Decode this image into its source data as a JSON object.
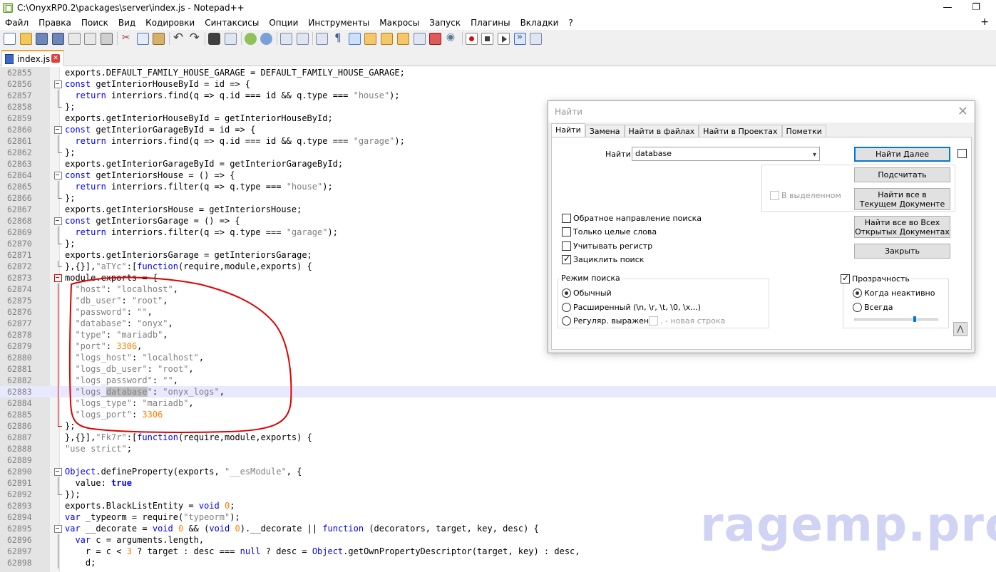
{
  "window": {
    "title": "C:\\OnyxRP0.2\\packages\\server\\index.js - Notepad++",
    "minimize_glyph": "—",
    "restore_glyph": "❐",
    "menu_close_glyph": "+"
  },
  "menu": [
    "Файл",
    "Правка",
    "Поиск",
    "Вид",
    "Кодировки",
    "Синтаксисы",
    "Опции",
    "Инструменты",
    "Макросы",
    "Запуск",
    "Плагины",
    "Вкладки",
    "?"
  ],
  "tab": {
    "label": "index.js",
    "close_glyph": "✕"
  },
  "code": [
    {
      "n": "62855",
      "fold": "",
      "h": "exports.DEFAULT_FAMILY_HOUSE_GARAGE = DEFAULT_FAMILY_HOUSE_GARAGE;"
    },
    {
      "n": "62856",
      "fold": "box",
      "h": "<span class=\"kw\">const</span> getInteriorHouseById = id =&gt; {"
    },
    {
      "n": "62857",
      "fold": "bar",
      "h": "  <span class=\"kw\">return</span> interriors.find(q =&gt; q.id === id &amp;&amp; q.type === <span class=\"str\">\"house\"</span>);"
    },
    {
      "n": "62858",
      "fold": "end",
      "h": "};"
    },
    {
      "n": "62859",
      "fold": "",
      "h": "exports.getInteriorHouseById = getInteriorHouseById;"
    },
    {
      "n": "62860",
      "fold": "box",
      "h": "<span class=\"kw\">const</span> getInteriorGarageById = id =&gt; {"
    },
    {
      "n": "62861",
      "fold": "bar",
      "h": "  <span class=\"kw\">return</span> interriors.find(q =&gt; q.id === id &amp;&amp; q.type === <span class=\"str\">\"garage\"</span>);"
    },
    {
      "n": "62862",
      "fold": "end",
      "h": "};"
    },
    {
      "n": "62863",
      "fold": "",
      "h": "exports.getInteriorGarageById = getInteriorGarageById;"
    },
    {
      "n": "62864",
      "fold": "box",
      "h": "<span class=\"kw\">const</span> getInteriorsHouse = () =&gt; {"
    },
    {
      "n": "62865",
      "fold": "bar",
      "h": "  <span class=\"kw\">return</span> interriors.filter(q =&gt; q.type === <span class=\"str\">\"house\"</span>);"
    },
    {
      "n": "62866",
      "fold": "end",
      "h": "};"
    },
    {
      "n": "62867",
      "fold": "",
      "h": "exports.getInteriorsHouse = getInteriorsHouse;"
    },
    {
      "n": "62868",
      "fold": "box",
      "h": "<span class=\"kw\">const</span> getInteriorsGarage = () =&gt; {"
    },
    {
      "n": "62869",
      "fold": "bar",
      "h": "  <span class=\"kw\">return</span> interriors.filter(q =&gt; q.type === <span class=\"str\">\"garage\"</span>);"
    },
    {
      "n": "62870",
      "fold": "end",
      "h": "};"
    },
    {
      "n": "62871",
      "fold": "",
      "h": "exports.getInteriorsGarage = getInteriorsGarage;"
    },
    {
      "n": "62872",
      "fold": "end",
      "h": "},{}],<span class=\"str\">\"aTYc\"</span>:[<span class=\"kw\">function</span>(require,module,exports) {"
    },
    {
      "n": "62873",
      "fold": "box red",
      "h": "module.exports = {"
    },
    {
      "n": "62874",
      "fold": "bar red",
      "h": "  <span class=\"str\">\"host\"</span>: <span class=\"str\">\"localhost\"</span>,"
    },
    {
      "n": "62875",
      "fold": "bar red",
      "h": "  <span class=\"str\">\"db_user\"</span>: <span class=\"str\">\"root\"</span>,"
    },
    {
      "n": "62876",
      "fold": "bar red",
      "h": "  <span class=\"str\">\"password\"</span>: <span class=\"str\">\"\"</span>,"
    },
    {
      "n": "62877",
      "fold": "bar red",
      "h": "  <span class=\"str\">\"database\"</span>: <span class=\"str\">\"onyx\"</span>,"
    },
    {
      "n": "62878",
      "fold": "bar red",
      "h": "  <span class=\"str\">\"type\"</span>: <span class=\"str\">\"mariadb\"</span>,"
    },
    {
      "n": "62879",
      "fold": "bar red",
      "h": "  <span class=\"str\">\"port\"</span>: <span class=\"num\">3306</span>,"
    },
    {
      "n": "62880",
      "fold": "bar red",
      "h": "  <span class=\"str\">\"logs_host\"</span>: <span class=\"str\">\"localhost\"</span>,"
    },
    {
      "n": "62881",
      "fold": "bar red",
      "h": "  <span class=\"str\">\"logs_db_user\"</span>: <span class=\"str\">\"root\"</span>,"
    },
    {
      "n": "62882",
      "fold": "bar red",
      "h": "  <span class=\"str\">\"logs_password\"</span>: <span class=\"str\">\"\"</span>,"
    },
    {
      "n": "62883",
      "fold": "bar red",
      "h": "  <span class=\"str\">\"logs_<span class=\"hl\">database</span>\"</span>: <span class=\"str\">\"onyx_logs\"</span>,",
      "current": true
    },
    {
      "n": "62884",
      "fold": "bar red",
      "h": "  <span class=\"str\">\"logs_type\"</span>: <span class=\"str\">\"mariadb\"</span>,"
    },
    {
      "n": "62885",
      "fold": "bar red",
      "h": "  <span class=\"str\">\"logs_port\"</span>: <span class=\"num\">3306</span>"
    },
    {
      "n": "62886",
      "fold": "end red",
      "h": "};"
    },
    {
      "n": "62887",
      "fold": "",
      "h": "},{}],<span class=\"str\">\"Fk7r\"</span>:[<span class=\"kw\">function</span>(require,module,exports) {"
    },
    {
      "n": "62888",
      "fold": "",
      "h": "<span class=\"str\">\"use strict\"</span>;"
    },
    {
      "n": "62889",
      "fold": "",
      "h": ""
    },
    {
      "n": "62890",
      "fold": "box",
      "h": "<span class=\"kw\">Object</span>.defineProperty(exports, <span class=\"str\">\"__esModule\"</span>, {"
    },
    {
      "n": "62891",
      "fold": "bar",
      "h": "  value: <span class=\"kw\"><b>true</b></span>"
    },
    {
      "n": "62892",
      "fold": "end",
      "h": "});"
    },
    {
      "n": "62893",
      "fold": "",
      "h": "exports.BlackListEntity = <span class=\"kw\">void</span> <span class=\"num\">0</span>;"
    },
    {
      "n": "62894",
      "fold": "",
      "h": "<span class=\"kw\">var</span> _typeorm = require(<span class=\"str\">\"typeorm\"</span>);"
    },
    {
      "n": "62895",
      "fold": "box",
      "h": "<span class=\"kw\">var</span> __decorate = <span class=\"kw\">void</span> <span class=\"num\">0</span> &amp;&amp; (<span class=\"kw\">void</span> <span class=\"num\">0</span>).__decorate || <span class=\"kw\">function</span> (decorators, target, key, desc) {"
    },
    {
      "n": "62896",
      "fold": "bar",
      "h": "  <span class=\"kw\">var</span> c = arguments.length,"
    },
    {
      "n": "62897",
      "fold": "bar",
      "h": "    r = c &lt; <span class=\"num\">3</span> ? target : desc === <span class=\"kw\">null</span> ? desc = <span class=\"kw\">Object</span>.getOwnPropertyDescriptor(target, key) : desc,"
    },
    {
      "n": "62898",
      "fold": "bar",
      "h": "    d;"
    }
  ],
  "watermark": "ragemp.pro",
  "find_dialog": {
    "title": "Найти",
    "close_glyph": "✕",
    "tabs": [
      "Найти",
      "Замена",
      "Найти в файлах",
      "Найти в Проектах",
      "Пометки"
    ],
    "find_label": "Найти:",
    "find_value": "database",
    "buttons": {
      "find_next": "Найти Далее",
      "count": "Подсчитать",
      "find_all_current": [
        "Найти все в",
        "Текущем Документе"
      ],
      "find_all_open": [
        "Найти все во Всех",
        "Открытых Документах"
      ],
      "close": "Закрыть"
    },
    "in_selection": "В выделенном",
    "options": [
      {
        "label": "Обратное направление поиска",
        "checked": false
      },
      {
        "label": "Только целые слова",
        "checked": false
      },
      {
        "label": "Учитывать регистр",
        "checked": false
      },
      {
        "label": "Зациклить поиск",
        "checked": true
      }
    ],
    "search_mode": {
      "label": "Режим поиска",
      "modes": [
        {
          "label": "Обычный",
          "selected": true
        },
        {
          "label": "Расширенный (\\n, \\r, \\t, \\0, \\x...)",
          "selected": false
        },
        {
          "label": "Регуляр. выражен.",
          "selected": false
        }
      ],
      "newline_option": ". - новая строка"
    },
    "transparency": {
      "label": "Прозрачность",
      "checked": true,
      "modes": [
        {
          "label": "Когда неактивно",
          "selected": true
        },
        {
          "label": "Всегда",
          "selected": false
        }
      ],
      "level": 0.72
    },
    "collapse_glyph": "⋀"
  }
}
